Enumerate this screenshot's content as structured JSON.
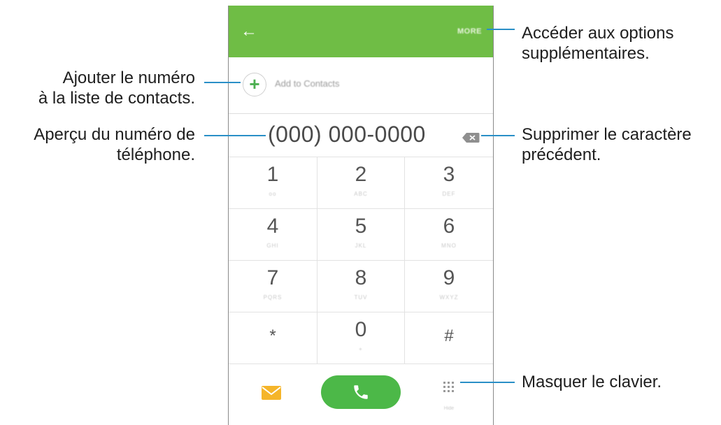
{
  "app": {
    "more_label": "MORE",
    "add_to_contacts_label": "Add to Contacts",
    "number": "(000) 000-0000"
  },
  "keypad": {
    "keys": [
      {
        "digit": "1",
        "sub": "oo"
      },
      {
        "digit": "2",
        "sub": "ABC"
      },
      {
        "digit": "3",
        "sub": "DEF"
      },
      {
        "digit": "4",
        "sub": "GHI"
      },
      {
        "digit": "5",
        "sub": "JKL"
      },
      {
        "digit": "6",
        "sub": "MNO"
      },
      {
        "digit": "7",
        "sub": "PQRS"
      },
      {
        "digit": "8",
        "sub": "TUV"
      },
      {
        "digit": "9",
        "sub": "WXYZ"
      },
      {
        "digit": "*",
        "sub": ""
      },
      {
        "digit": "0",
        "sub": "+"
      },
      {
        "digit": "#",
        "sub": ""
      }
    ],
    "hide_sub": "Hide"
  },
  "colors": {
    "appbar": "#6fbd45",
    "call_button": "#4cb848",
    "message_icon": "#f5b52a",
    "callout_line": "#2a8fc7"
  },
  "icons": {
    "back": "arrow-left-icon",
    "add": "plus-icon",
    "backspace": "backspace-icon",
    "message": "envelope-icon",
    "call": "phone-icon",
    "keypad": "keypad-dots-icon"
  },
  "callouts": {
    "options_line1": "Accéder aux options",
    "options_line2": "supplémentaires.",
    "add_line1": "Ajouter le numéro",
    "add_line2": "à la liste de contacts.",
    "preview_line1": "Aperçu du numéro de",
    "preview_line2": "téléphone.",
    "delete_line1": "Supprimer le caractère",
    "delete_line2": "précédent.",
    "hide_keypad": "Masquer le clavier."
  }
}
